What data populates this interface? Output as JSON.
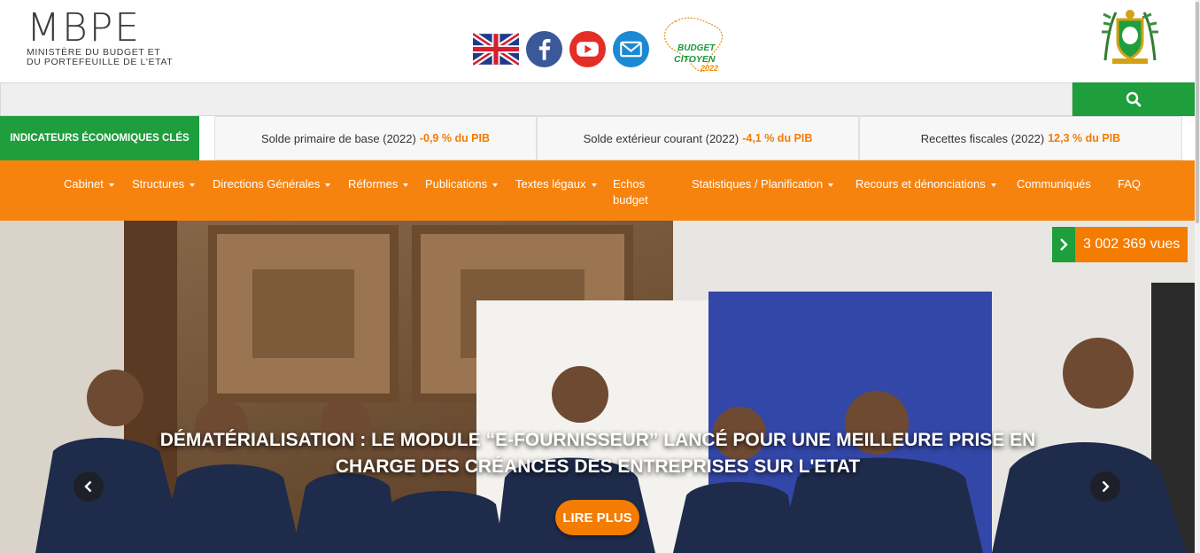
{
  "header": {
    "logo": {
      "mark": "MBPE",
      "line1": "Ministère du Budget et",
      "line2": "du Portefeuille de l'Etat"
    },
    "social_icons": [
      "uk-flag-icon",
      "facebook-icon",
      "youtube-icon",
      "email-icon",
      "budget-citoyen-logo"
    ],
    "budget_citoyen": {
      "line1": "BUDGET",
      "line2": "CITOYEN",
      "year": "2022"
    }
  },
  "search": {
    "value": "",
    "placeholder": "",
    "button_icon": "search-icon"
  },
  "indicators": {
    "label": "Indicateurs économiques clés",
    "items": [
      {
        "label": "Solde primaire de base (2022)",
        "value": "-0,9 % du PIB"
      },
      {
        "label": "Solde extérieur courant (2022)",
        "value": "-4,1 % du PIB"
      },
      {
        "label": "Recettes fiscales (2022)",
        "value": "12,3 % du PIB"
      }
    ]
  },
  "nav": {
    "items": [
      {
        "label": "Cabinet"
      },
      {
        "label": "Structures"
      },
      {
        "label": "Directions Générales"
      },
      {
        "label": "Réformes"
      },
      {
        "label": "Publications"
      },
      {
        "label": "Textes légaux"
      },
      {
        "label": "Echos budget"
      },
      {
        "label": "Statistiques / Planification"
      },
      {
        "label": "Recours et dénonciations"
      },
      {
        "label": "Communiqués"
      },
      {
        "label": "FAQ"
      }
    ]
  },
  "hero": {
    "views": "3 002 369 vues",
    "caption": "Dématérialisation : le module “E-FOURNISSEUR” lancé pour une meilleure prise en charge des créances des entreprises sur l'Etat",
    "cta": "LIRE PLUS",
    "prev_icon": "chevron-left-icon",
    "next_icon": "chevron-right-icon"
  },
  "colors": {
    "green": "#1e9e3c",
    "orange": "#f7830f",
    "accent_orange": "#f47c00"
  }
}
